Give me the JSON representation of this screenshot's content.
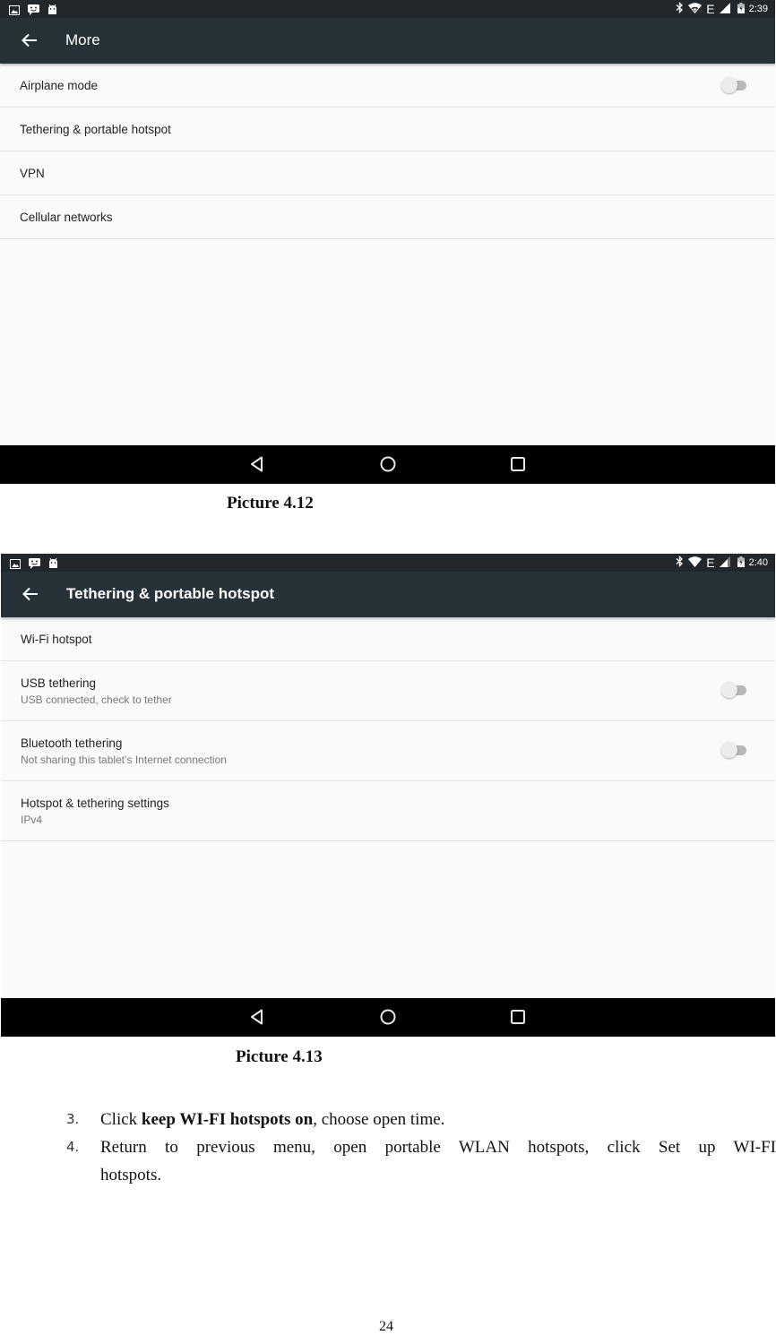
{
  "screenshots": [
    {
      "caption": "Picture 4.12",
      "status_bar": {
        "left_icons": [
          "image-notification-icon",
          "message-notification-icon",
          "android-debug-icon"
        ],
        "right_icons": [
          "bluetooth-icon",
          "wifi-icon",
          "edge-network-icon",
          "signal-icon",
          "battery-charging-icon"
        ],
        "network_label": "E",
        "time": "2:39"
      },
      "app_bar": {
        "back_icon": "arrow-back-icon",
        "title": "More"
      },
      "items": [
        {
          "label": "Airplane mode",
          "toggle": true,
          "toggle_on": false
        },
        {
          "label": "Tethering & portable hotspot"
        },
        {
          "label": "VPN"
        },
        {
          "label": "Cellular networks"
        }
      ],
      "nav_bar": {
        "icons": [
          "back-triangle-icon",
          "home-circle-icon",
          "recents-square-icon"
        ]
      }
    },
    {
      "caption": "Picture 4.13",
      "status_bar": {
        "left_icons": [
          "image-notification-icon",
          "message-notification-icon",
          "android-debug-icon"
        ],
        "right_icons": [
          "bluetooth-icon",
          "wifi-icon",
          "edge-network-icon",
          "signal-icon",
          "battery-charging-icon"
        ],
        "network_label": "E",
        "time": "2:40"
      },
      "app_bar": {
        "back_icon": "arrow-back-icon",
        "title": "Tethering & portable hotspot"
      },
      "items": [
        {
          "label": "Wi-Fi hotspot"
        },
        {
          "label": "USB tethering",
          "summary": "USB connected, check to tether",
          "toggle": true,
          "toggle_on": false
        },
        {
          "label": "Bluetooth tethering",
          "summary": "Not sharing this tablet’s Internet connection",
          "toggle": true,
          "toggle_on": false
        },
        {
          "label": "Hotspot & tethering settings",
          "summary": "IPv4"
        }
      ],
      "nav_bar": {
        "icons": [
          "back-triangle-icon",
          "home-circle-icon",
          "recents-square-icon"
        ]
      }
    }
  ],
  "steps": [
    {
      "number": "3.",
      "prefix": "Click ",
      "bold": "keep WI-FI hotspots on",
      "suffix": ", choose open time."
    },
    {
      "number": "4.",
      "text": "Return to previous menu, open portable WLAN hotspots, click Set up WI-FI hotspots."
    }
  ],
  "page_number": "24",
  "colors": {
    "status_bar": "#21272b",
    "app_bar": "#263238",
    "list_background": "#fafafa",
    "divider": "#e4e4e4",
    "nav_bar": "#000000",
    "toggle_track_off": "#b8b8b8",
    "toggle_thumb_off": "#ececec"
  }
}
